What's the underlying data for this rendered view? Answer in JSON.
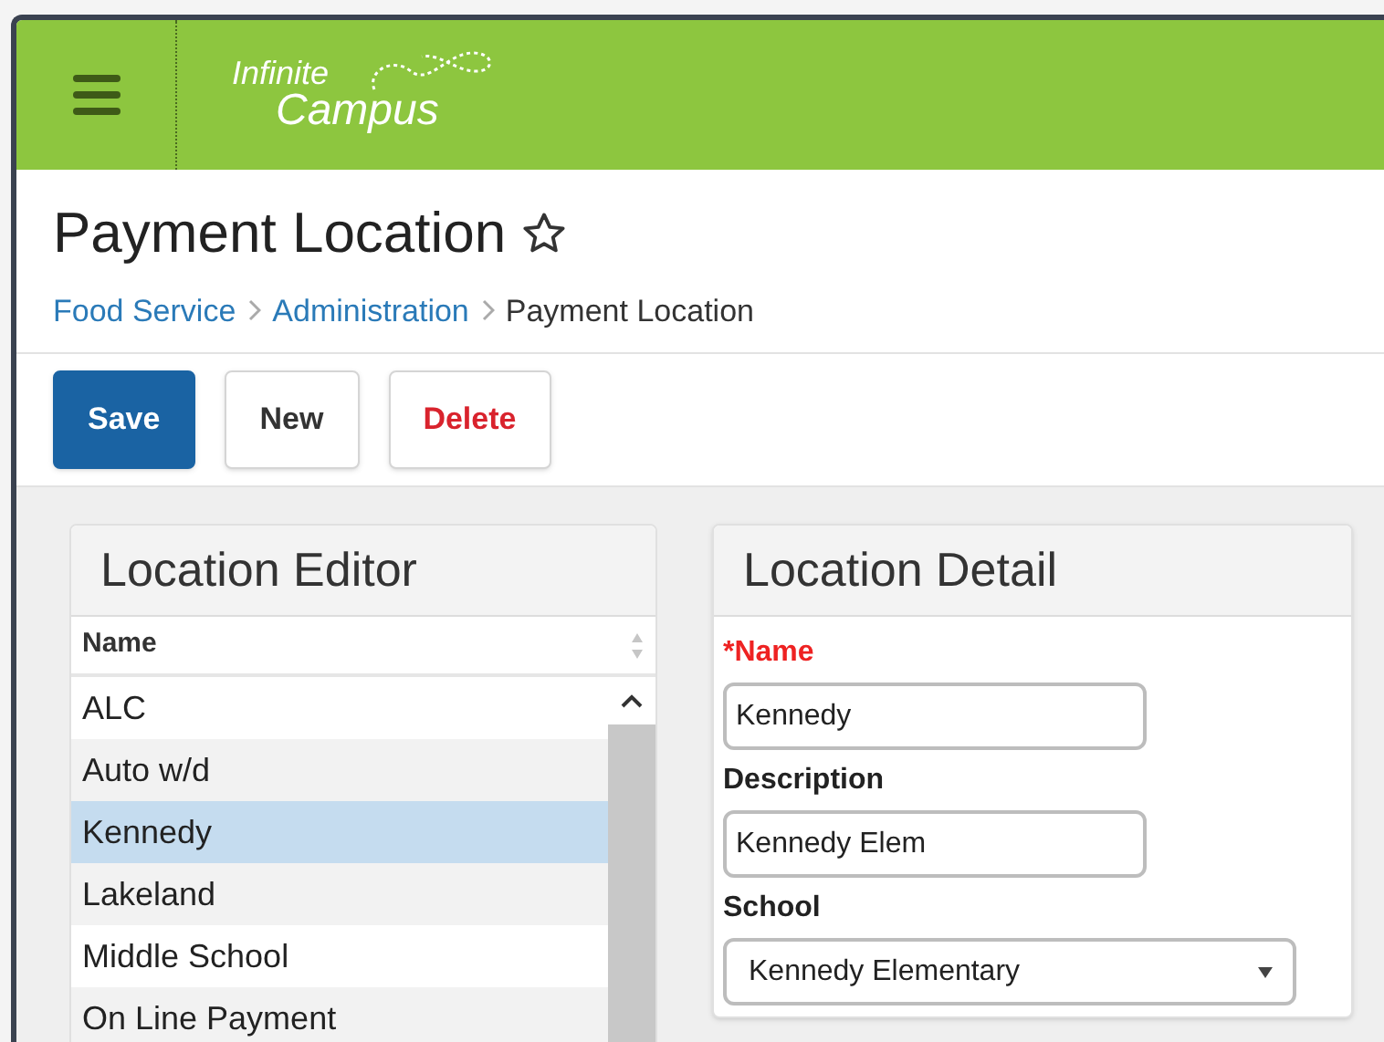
{
  "header": {
    "logo": {
      "line_1": "Infinite",
      "line_2": "Campus"
    }
  },
  "page": {
    "title": "Payment Location",
    "favorite": false,
    "breadcrumbs": [
      {
        "label": "Food Service",
        "kind": "link"
      },
      {
        "label": "Administration",
        "kind": "link"
      },
      {
        "label": "Payment Location",
        "kind": "current"
      }
    ]
  },
  "toolbar": [
    {
      "label": "Save",
      "kind": "primary"
    },
    {
      "label": "New",
      "kind": "default"
    },
    {
      "label": "Delete",
      "kind": "danger"
    }
  ],
  "location_editor": {
    "title": "Location Editor",
    "column": "Name",
    "rows": [
      {
        "name": "ALC",
        "selected": false
      },
      {
        "name": "Auto w/d",
        "selected": false
      },
      {
        "name": "Kennedy",
        "selected": true
      },
      {
        "name": "Lakeland",
        "selected": false
      },
      {
        "name": "Middle School",
        "selected": false
      },
      {
        "name": "On Line Payment",
        "selected": false
      }
    ]
  },
  "location_detail": {
    "title": "Location Detail",
    "fields": [
      {
        "label": "*Name",
        "required": true,
        "kind": "text",
        "value": "Kennedy"
      },
      {
        "label": "Description",
        "required": false,
        "kind": "text",
        "value": "Kennedy Elem"
      },
      {
        "label": "School",
        "required": false,
        "kind": "select",
        "value": "Kennedy Elementary"
      }
    ]
  }
}
